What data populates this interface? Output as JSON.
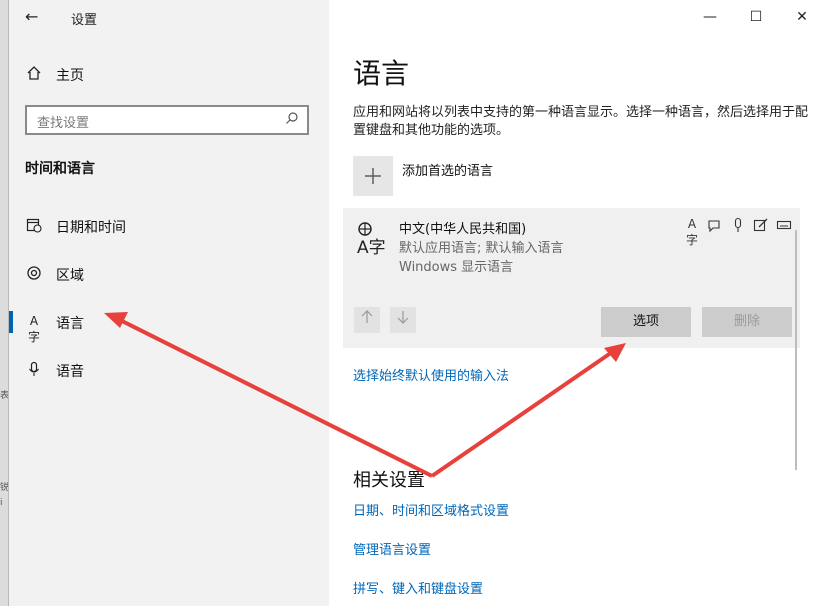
{
  "window": {
    "title": "设置"
  },
  "caption": {
    "minimize": "—",
    "maximize": "☐",
    "close": "✕"
  },
  "sidebar": {
    "home": "主页",
    "search_placeholder": "查找设置",
    "section_title": "时间和语言",
    "items": [
      {
        "label": "日期和时间",
        "icon": "calendar-clock-icon"
      },
      {
        "label": "区域",
        "icon": "globe-region-icon"
      },
      {
        "label": "语言",
        "icon": "language-icon",
        "active": true
      },
      {
        "label": "语音",
        "icon": "microphone-icon"
      }
    ]
  },
  "main": {
    "title": "语言",
    "description": "应用和网站将以列表中支持的第一种语言显示。选择一种语言，然后选择用于配置键盘和其他功能的选项。",
    "add_language_label": "添加首选的语言",
    "language_card": {
      "name": "中文(中华人民共和国)",
      "sub1": "默认应用语言; 默认输入语言",
      "sub2": "Windows 显示语言",
      "options_label": "选项",
      "remove_label": "删除"
    },
    "input_method_link": "选择始终默认使用的输入法",
    "related_title": "相关设置",
    "related_links": [
      "日期、时间和区域格式设置",
      "管理语言设置",
      "拼写、键入和键盘设置"
    ]
  },
  "annotation_color": "#e8413c"
}
